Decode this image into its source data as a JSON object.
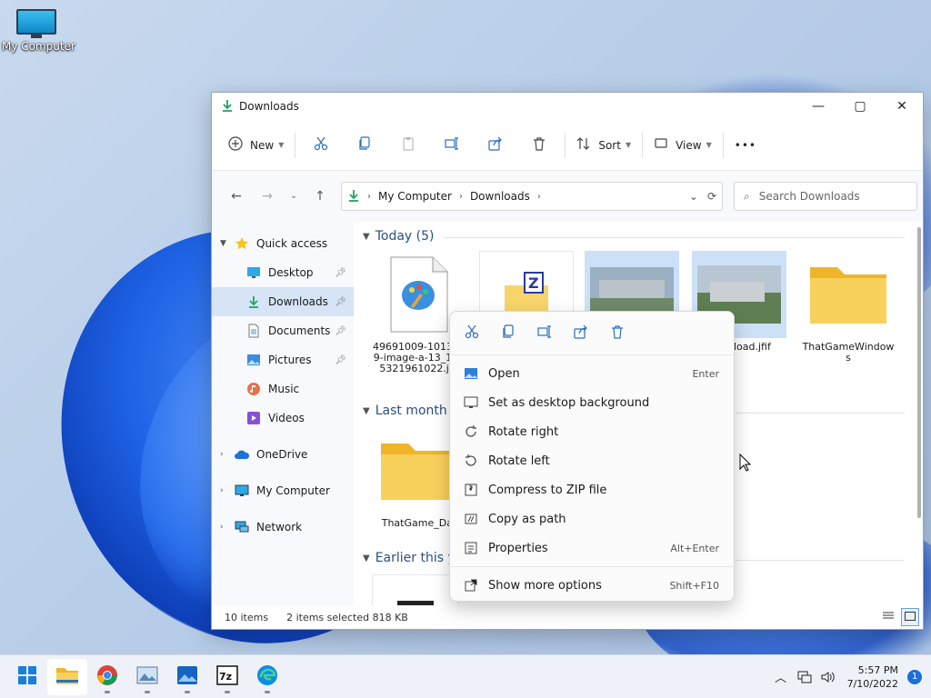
{
  "desktop": {
    "icon_label": "My Computer"
  },
  "window": {
    "title": "Downloads",
    "controls": {
      "minimize": "—",
      "maximize": "▢",
      "close": "✕"
    }
  },
  "toolbar": {
    "new_label": "New",
    "sort_label": "Sort",
    "view_label": "View",
    "more": "•••"
  },
  "address": {
    "crumbs": [
      "My Computer",
      "Downloads"
    ],
    "search_placeholder": "Search Downloads"
  },
  "nav": {
    "quick_access": "Quick access",
    "items": [
      {
        "label": "Desktop"
      },
      {
        "label": "Downloads"
      },
      {
        "label": "Documents"
      },
      {
        "label": "Pictures"
      },
      {
        "label": "Music"
      },
      {
        "label": "Videos"
      }
    ],
    "onedrive": "OneDrive",
    "my_computer": "My Computer",
    "network": "Network"
  },
  "groups": {
    "today": "Today (5)",
    "last_month": "Last month (",
    "earlier": "Earlier this y"
  },
  "files": {
    "f1": "49691009-1013539-image-a-13_1635321961022.jfif",
    "f4": "load.jfif",
    "f5": "ThatGameWindows",
    "f6": "ThatGame_Dat"
  },
  "status": {
    "count": "10 items",
    "selected": "2 items selected  818 KB"
  },
  "context_menu": {
    "items": [
      {
        "label": "Open",
        "shortcut": "Enter"
      },
      {
        "label": "Set as desktop background",
        "shortcut": ""
      },
      {
        "label": "Rotate right",
        "shortcut": ""
      },
      {
        "label": "Rotate left",
        "shortcut": ""
      },
      {
        "label": "Compress to ZIP file",
        "shortcut": ""
      },
      {
        "label": "Copy as path",
        "shortcut": ""
      },
      {
        "label": "Properties",
        "shortcut": "Alt+Enter"
      }
    ],
    "more": {
      "label": "Show more options",
      "shortcut": "Shift+F10"
    }
  },
  "taskbar": {
    "time": "5:57 PM",
    "date": "7/10/2022",
    "notifications": "1"
  },
  "colors": {
    "accent": "#1a6fd8",
    "folder": "#f8c94a",
    "download_green": "#1fa463"
  }
}
